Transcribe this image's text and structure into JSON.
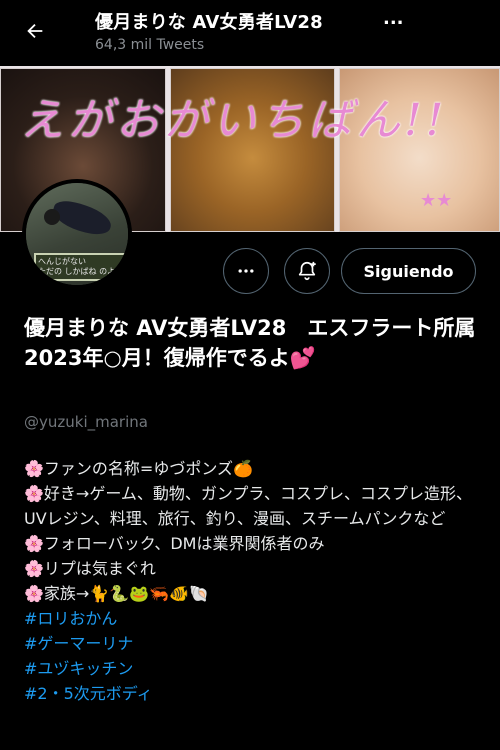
{
  "header": {
    "title": "優月まりな AV女勇者LV28",
    "more": "...",
    "subtitle": "64,3 mil Tweets",
    "back_icon": "arrow-left-icon"
  },
  "banner": {
    "text": "えがおがいちばん!!",
    "stars": "★★"
  },
  "avatar": {
    "caption_line1": "へんじがない",
    "caption_line2": "ただの しかばね のようだ。"
  },
  "actions": {
    "more_icon": "more-horizontal-icon",
    "notify_icon": "bell-plus-icon",
    "follow_label": "Siguiendo"
  },
  "profile": {
    "name": "優月まりな AV女勇者LV28　エスフラート所属　2023年○月！復帰作でるよ💕",
    "handle": "@yuzuki_marina",
    "bio": [
      "🌸ファンの名称=ゆづポンズ🍊",
      "🌸好き→ゲーム、動物、ガンプラ、コスプレ、コスプレ造形、UVレジン、料理、旅行、釣り、漫画、スチームパンクなど",
      "🌸フォローバック、DMは業界関係者のみ",
      "🌸リプは気まぐれ",
      "🌸家族→🐈🐍🐸🦐🐠🐚"
    ],
    "hashtags": [
      "#ロリおかん",
      "#ゲーマーリナ",
      "#ユヅキッチン",
      "#2・5次元ボディ"
    ]
  },
  "colors": {
    "background": "#000000",
    "link": "#1d9bf0",
    "muted": "#71767b",
    "border": "#536471"
  }
}
